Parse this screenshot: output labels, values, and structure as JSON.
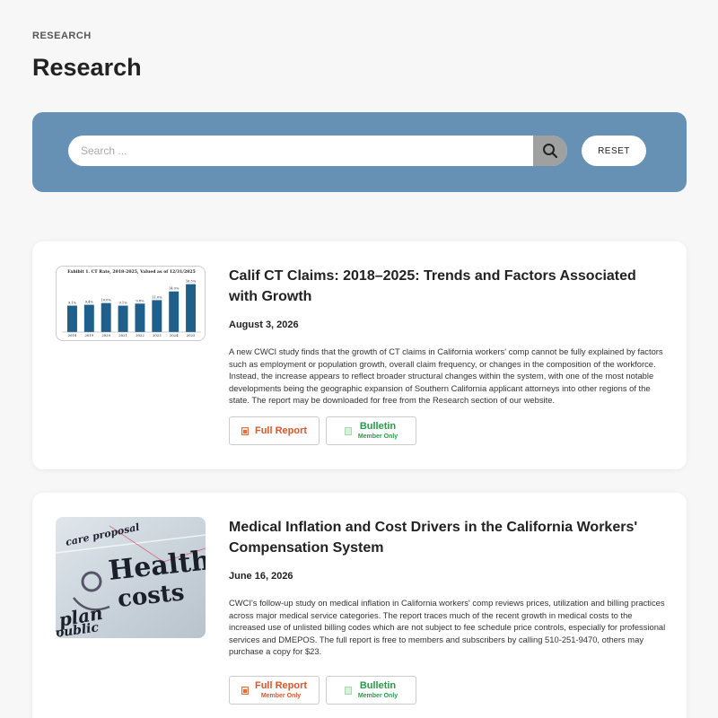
{
  "breadcrumb": "RESEARCH",
  "page_title": "Research",
  "search": {
    "placeholder": "Search ...",
    "reset_label": "RESET"
  },
  "articles": [
    {
      "title": "Calif CT Claims: 2018–2025: Trends and Factors Associated with Growth",
      "date": "August 3, 2026",
      "description": "A new CWCI study finds that the growth of CT claims in California workers' comp cannot be fully explained by factors such as employment or population growth, overall claim frequency, or changes in the composition of the workforce. Instead, the increase appears to reflect broader structural changes within the system, with one of the most notable developments being the geographic expansion of Southern California applicant attorneys into other regions of the state. The report may be downloaded for free from the Research section of our website.",
      "thumbnail": {
        "title": "Exhibit 1. CT Rate, 2018-2025, Valued as of 12/31/2025",
        "chart_data": {
          "type": "bar",
          "categories": [
            "2018",
            "2019",
            "2020",
            "2021",
            "2022",
            "2023",
            "2024",
            "2025"
          ],
          "values": [
            9.1,
            9.4,
            10.0,
            9.1,
            9.8,
            11.0,
            14.0,
            16.5
          ],
          "labels": [
            "9.1%",
            "9.4%",
            "10.0%",
            "9.1%",
            "9.8%",
            "11.0%",
            "14.0%",
            "16.5%"
          ],
          "bar_color": "#1f5f8b"
        }
      },
      "buttons": [
        {
          "label": "Full Report",
          "sub": "",
          "color": "#e0542a"
        },
        {
          "label": "Bulletin",
          "sub": "Member Only",
          "color": "#2a9a4a"
        }
      ]
    },
    {
      "title": "Medical Inflation and Cost Drivers in the California Workers' Compensation System",
      "date": "June 16, 2026",
      "description": "CWCI's follow-up study on medical inflation in California workers' comp reviews prices, utilization and billing practices across major medical service categories. The report traces much of the recent growth in medical costs to the increased use of unlisted billing codes which are not subject to fee schedule price controls, especially for professional services and DMEPOS.  The full report is free to members and subscribers by calling 510-251-9470, others may purchase a copy for $23.",
      "thumbnail": {
        "words": [
          "Health",
          "costs",
          "care proposal",
          "plan",
          "public"
        ]
      },
      "buttons": [
        {
          "label": "Full Report",
          "sub": "Member Only",
          "color": "#e0542a"
        },
        {
          "label": "Bulletin",
          "sub": "Member Only",
          "color": "#2a9a4a"
        }
      ]
    }
  ]
}
